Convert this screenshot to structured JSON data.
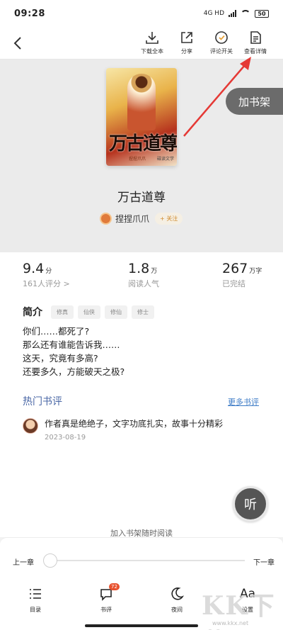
{
  "status_bar": {
    "time": "09:28",
    "network": "4G HD",
    "battery": "50"
  },
  "toolbar": {
    "download_label": "下载全本",
    "share_label": "分享",
    "comment_toggle_label": "评论开关",
    "detail_label": "查看详情"
  },
  "book": {
    "cover_title": "万古道尊",
    "cover_author": "捏捏爪爪",
    "cover_publisher": "磁读文学",
    "title": "万古道尊",
    "author": "捏捏爪爪",
    "follow_label": "+ 关注"
  },
  "add_shelf_label": "加书架",
  "stats": {
    "score": "9.4",
    "score_unit": "分",
    "score_sub": "161人评分 >",
    "popularity": "1.8",
    "popularity_unit": "万",
    "popularity_sub": "阅读人气",
    "words": "267",
    "words_unit": "万字",
    "words_sub": "已完结"
  },
  "intro": {
    "label": "简介",
    "tags": [
      "修真",
      "仙侠",
      "修仙",
      "修士"
    ],
    "lines": [
      "你们……都死了?",
      "那么还有谁能告诉我……",
      "这天，究竟有多高?",
      "还要多久，方能破天之极?"
    ]
  },
  "reviews": {
    "title": "热门书评",
    "more_label": "更多书评",
    "items": [
      {
        "text": "作者真是绝绝子，文字功底扎实，故事十分精彩",
        "date": "2023-08-19"
      }
    ]
  },
  "bottom_hint": "加入书架随时阅读",
  "listen_label": "听",
  "controls": {
    "prev_label": "上一章",
    "next_label": "下一章",
    "progress": 0.0,
    "nav": {
      "toc": "目录",
      "review": "书评",
      "review_badge": "72",
      "night": "夜间",
      "settings": "设置",
      "settings_glyph": "Aa"
    }
  },
  "watermark": {
    "text": "KK下载",
    "url": "www.kkx.net"
  },
  "colors": {
    "accent_blue": "#4a67a6",
    "link_blue": "#3b7ac6",
    "badge_red": "#e8512e",
    "arrow_red": "#e53935"
  }
}
